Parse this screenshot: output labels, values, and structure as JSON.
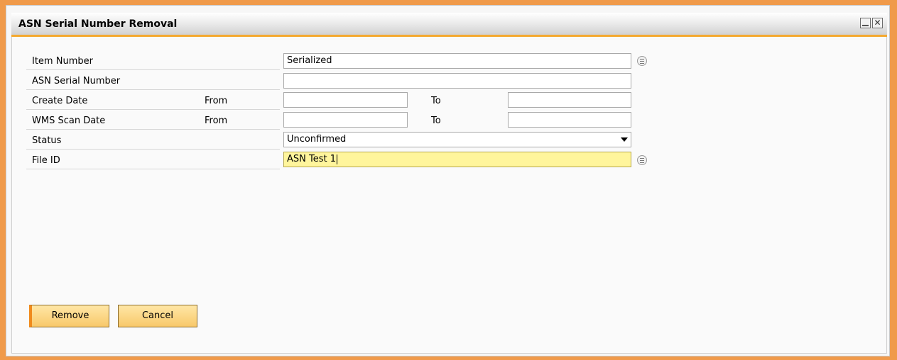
{
  "window": {
    "title": "ASN Serial Number Removal"
  },
  "form": {
    "item_number": {
      "label": "Item Number",
      "value": "Serialized"
    },
    "asn_serial_number": {
      "label": "ASN Serial Number",
      "value": ""
    },
    "create_date": {
      "label": "Create Date",
      "from_label": "From",
      "to_label": "To",
      "from_value": "",
      "to_value": ""
    },
    "wms_scan_date": {
      "label": "WMS Scan Date",
      "from_label": "From",
      "to_label": "To",
      "from_value": "",
      "to_value": ""
    },
    "status": {
      "label": "Status",
      "selected": "Unconfirmed"
    },
    "file_id": {
      "label": "File ID",
      "value": "ASN Test 1"
    }
  },
  "buttons": {
    "remove": "Remove",
    "cancel": "Cancel"
  },
  "colors": {
    "frame": "#f09a4a",
    "accent": "#f4a930",
    "focused_field": "#fff59c",
    "button": "#f8c86a"
  },
  "icons": [
    "minimize-icon",
    "close-icon",
    "lookup-icon"
  ]
}
